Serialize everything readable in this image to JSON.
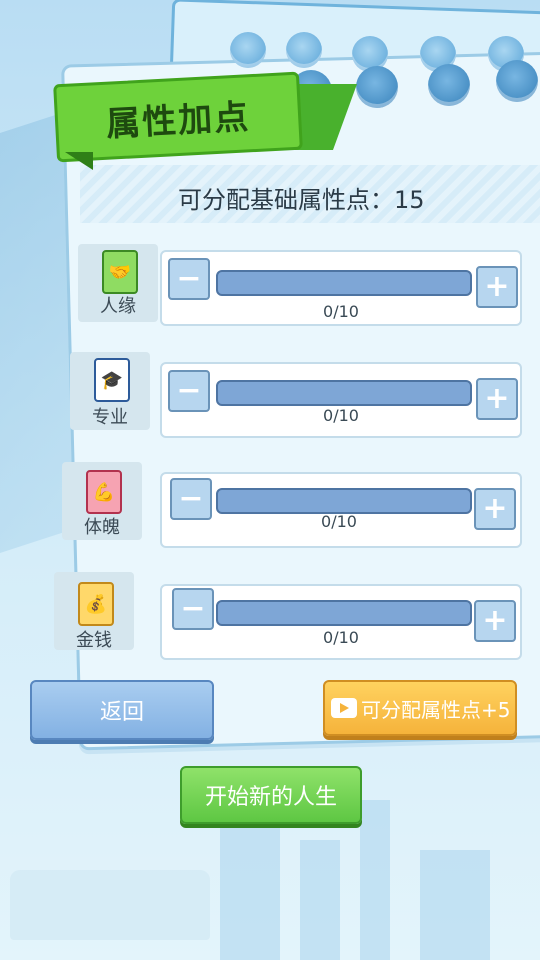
{
  "header": {
    "title": "属性加点"
  },
  "points_text": "可分配基础属性点：15",
  "attributes": [
    {
      "label": "人缘",
      "value": "0/10",
      "icon": "handshake-icon",
      "color": "#6fcf4a"
    },
    {
      "label": "专业",
      "value": "0/10",
      "icon": "graduation-cap-icon",
      "color": "#2d5b9a"
    },
    {
      "label": "体魄",
      "value": "0/10",
      "icon": "muscle-arm-icon",
      "color": "#e0607c"
    },
    {
      "label": "金钱",
      "value": "0/10",
      "icon": "coin-bag-icon",
      "color": "#f2b23a"
    }
  ],
  "controls": {
    "minus": "−",
    "plus": "+"
  },
  "buttons": {
    "back": "返回",
    "add_points": "可分配属性点+5",
    "start": "开始新的人生"
  },
  "colors": {
    "bar_fill": "#7ea6d6",
    "title_ribbon": "#6ed23b",
    "add_button": "#f5b33b",
    "start_button": "#5ec743"
  }
}
